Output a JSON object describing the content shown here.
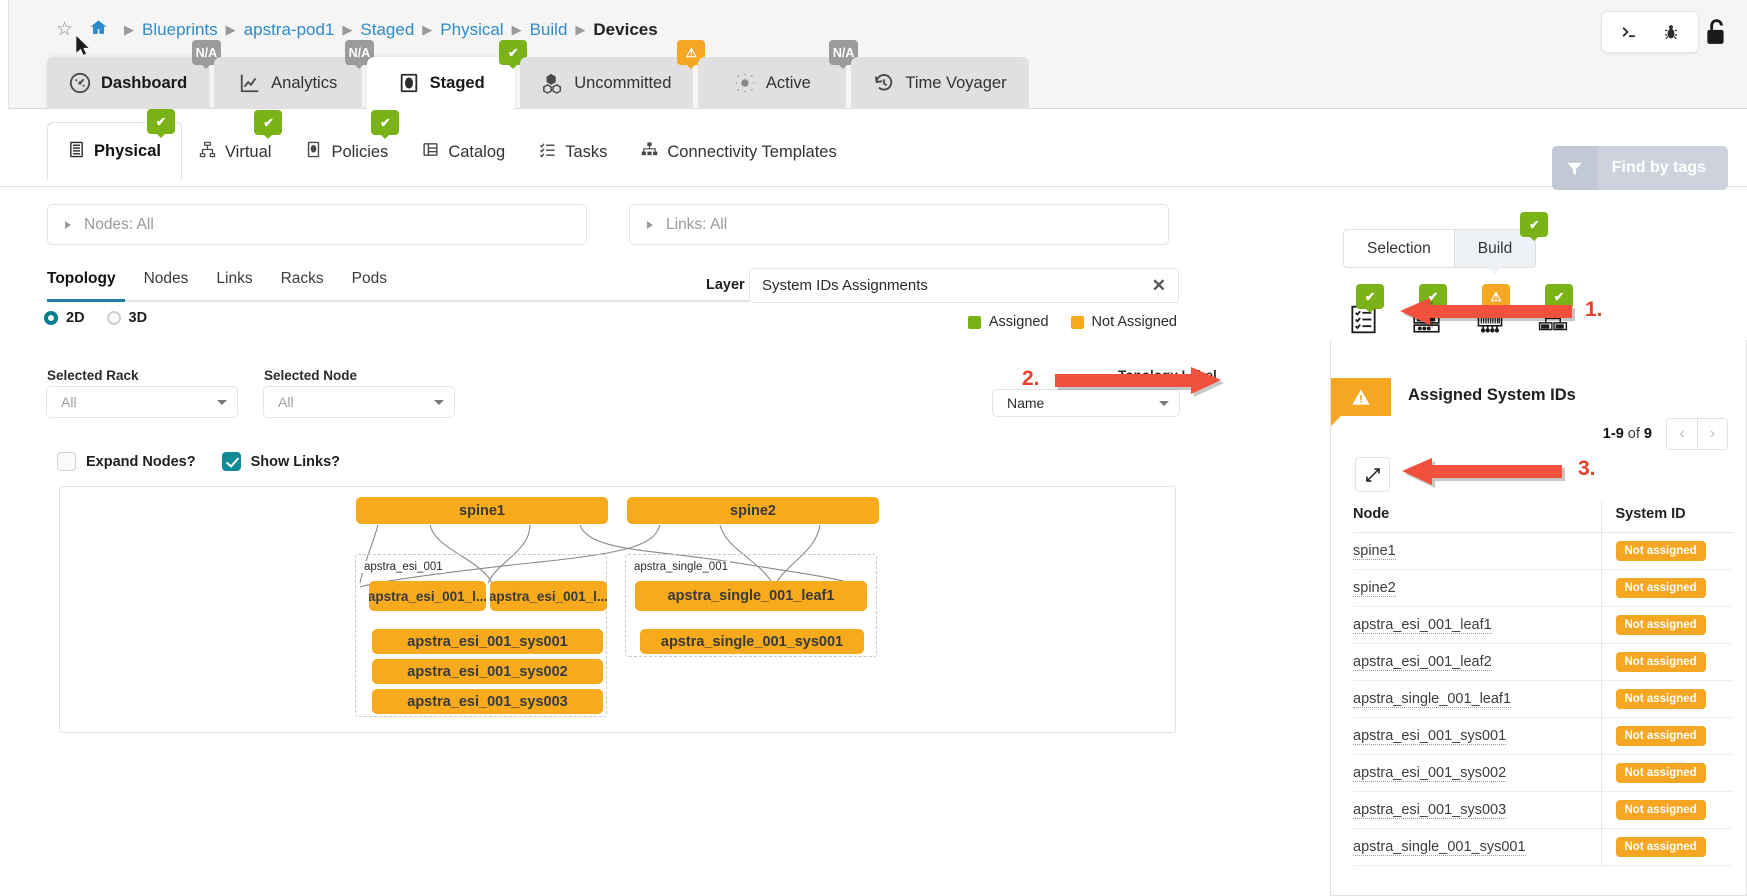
{
  "breadcrumb": {
    "star_icon": "star-icon",
    "home_icon": "home-icon",
    "items": [
      "Blueprints",
      "apstra-pod1",
      "Staged",
      "Physical",
      "Build"
    ],
    "current": "Devices"
  },
  "main_tabs": [
    {
      "label": "Dashboard",
      "icon": "gauge-icon",
      "badge": "N/A",
      "badge_type": "na",
      "active": false
    },
    {
      "label": "Analytics",
      "icon": "chart-icon",
      "badge": "N/A",
      "badge_type": "na",
      "active": false
    },
    {
      "label": "Staged",
      "icon": "staged-icon",
      "badge": "✔",
      "badge_type": "ok",
      "active": true
    },
    {
      "label": "Uncommitted",
      "icon": "cubes-icon",
      "badge": "⚠",
      "badge_type": "warn",
      "active": false
    },
    {
      "label": "Active",
      "icon": "active-icon",
      "badge": "N/A",
      "badge_type": "na",
      "active": false
    },
    {
      "label": "Time Voyager",
      "icon": "history-icon",
      "badge": "",
      "badge_type": "",
      "active": false
    }
  ],
  "top_right": {
    "terminal_icon": "terminal-icon",
    "bug_icon": "bug-icon",
    "lock_icon": "unlock-icon"
  },
  "sub_nav": [
    {
      "label": "Physical",
      "icon": "rack-icon",
      "badge": "✔",
      "active": true
    },
    {
      "label": "Virtual",
      "icon": "virtual-icon",
      "badge": "✔",
      "active": false
    },
    {
      "label": "Policies",
      "icon": "policy-icon",
      "badge": "✔",
      "active": false
    },
    {
      "label": "Catalog",
      "icon": "catalog-icon",
      "badge": "",
      "active": false
    },
    {
      "label": "Tasks",
      "icon": "tasks-icon",
      "badge": "",
      "active": false
    },
    {
      "label": "Connectivity Templates",
      "icon": "sitemap-icon",
      "badge": "",
      "active": false
    }
  ],
  "find_by_tags": {
    "label": "Find by tags",
    "icon": "filter-icon"
  },
  "filters": {
    "nodes": "Nodes: All",
    "links": "Links: All"
  },
  "left_tabs": [
    {
      "label": "Topology",
      "active": true
    },
    {
      "label": "Nodes",
      "active": false
    },
    {
      "label": "Links",
      "active": false
    },
    {
      "label": "Racks",
      "active": false
    },
    {
      "label": "Pods",
      "active": false
    }
  ],
  "dimension_radio": {
    "options": [
      "2D",
      "3D"
    ],
    "selected": "2D"
  },
  "selected_rack": {
    "label": "Selected Rack",
    "value": "All"
  },
  "selected_node": {
    "label": "Selected Node",
    "value": "All"
  },
  "checkboxes": [
    {
      "label": "Expand Nodes?",
      "checked": false
    },
    {
      "label": "Show Links?",
      "checked": true
    }
  ],
  "layer": {
    "label": "Layer",
    "value": "System IDs Assignments",
    "clear_icon": "close-icon"
  },
  "legend": [
    {
      "label": "Assigned",
      "color": "#7ab317"
    },
    {
      "label": "Not Assigned",
      "color": "#f6aa1c"
    }
  ],
  "topology_label": {
    "label": "Topology Label",
    "value": "Name"
  },
  "topology": {
    "spines": [
      "spine1",
      "spine2"
    ],
    "racks": [
      {
        "name": "apstra_esi_001",
        "leafs": [
          "apstra_esi_001_l...",
          "apstra_esi_001_l..."
        ],
        "systems": [
          "apstra_esi_001_sys001",
          "apstra_esi_001_sys002",
          "apstra_esi_001_sys003"
        ]
      },
      {
        "name": "apstra_single_001",
        "leafs": [
          "apstra_single_001_leaf1"
        ],
        "systems": [
          "apstra_single_001_sys001"
        ]
      }
    ]
  },
  "right_panel": {
    "tabs": [
      {
        "label": "Selection",
        "active": false,
        "badge": ""
      },
      {
        "label": "Build",
        "active": true,
        "badge": "✔"
      }
    ],
    "build_icons": [
      {
        "name": "checklist-icon",
        "badge": "✔",
        "badge_type": "ok",
        "active": false
      },
      {
        "name": "device-rack-icon",
        "badge": "✔",
        "badge_type": "ok",
        "active": false
      },
      {
        "name": "system-id-icon",
        "badge": "⚠",
        "badge_type": "warn",
        "active": true
      },
      {
        "name": "cabling-icon",
        "badge": "✔",
        "badge_type": "ok",
        "active": false
      }
    ],
    "title": "Assigned System IDs",
    "warning_icon": "warning-icon",
    "pagination": {
      "range": "1-9",
      "of": "of",
      "total": "9",
      "prev_icon": "chevron-left-icon",
      "next_icon": "chevron-right-icon"
    },
    "edit_icon": "edit-icon",
    "table": {
      "columns": [
        "Node",
        "System ID"
      ],
      "rows": [
        {
          "node": "spine1",
          "system_id": "Not assigned"
        },
        {
          "node": "spine2",
          "system_id": "Not assigned"
        },
        {
          "node": "apstra_esi_001_leaf1",
          "system_id": "Not assigned"
        },
        {
          "node": "apstra_esi_001_leaf2",
          "system_id": "Not assigned"
        },
        {
          "node": "apstra_single_001_leaf1",
          "system_id": "Not assigned"
        },
        {
          "node": "apstra_esi_001_sys001",
          "system_id": "Not assigned"
        },
        {
          "node": "apstra_esi_001_sys002",
          "system_id": "Not assigned"
        },
        {
          "node": "apstra_esi_001_sys003",
          "system_id": "Not assigned"
        },
        {
          "node": "apstra_single_001_sys001",
          "system_id": "Not assigned"
        }
      ]
    }
  },
  "annotations": [
    {
      "number": "1."
    },
    {
      "number": "2."
    },
    {
      "number": "3."
    }
  ],
  "colors": {
    "accent_blue": "#2e8bc9",
    "ok_green": "#7ab317",
    "warn_orange": "#f5a623",
    "node_orange": "#f6aa1c",
    "teal": "#128a96",
    "annotation_red": "#e8402a"
  }
}
